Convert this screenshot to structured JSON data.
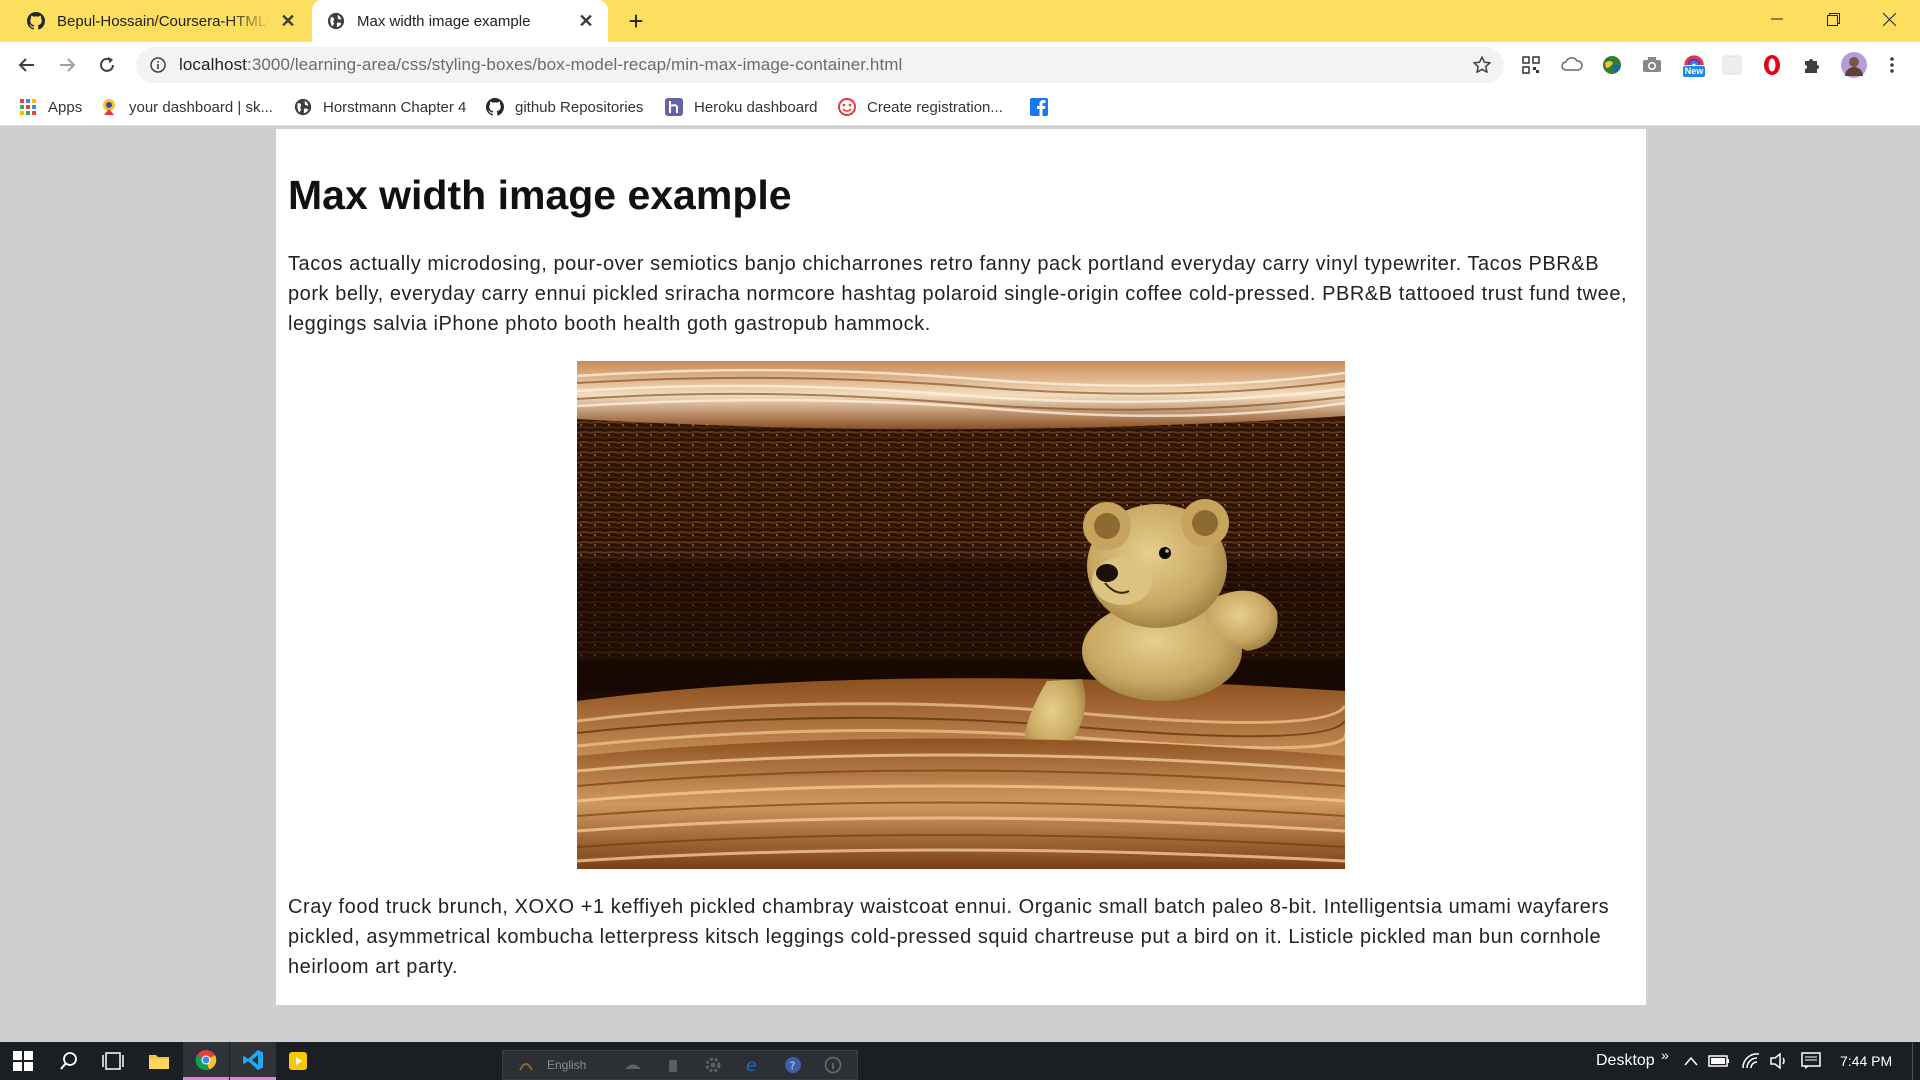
{
  "browser": {
    "tabs": [
      {
        "title": "Bepul-Hossain/Coursera-HTML-C",
        "icon": "github-icon",
        "active": false
      },
      {
        "title": "Max width image example",
        "icon": "globe-icon",
        "active": true
      }
    ],
    "new_tab_label": "+",
    "url": {
      "host": "localhost",
      "path": ":3000/learning-area/css/styling-boxes/box-model-recap/min-max-image-container.html"
    },
    "new_badge": "New",
    "bookmarks": [
      {
        "label": "Apps",
        "icon": "apps-grid-icon"
      },
      {
        "label": "your dashboard | sk...",
        "icon": "skill-logo-icon"
      },
      {
        "label": "Horstmann Chapter 4",
        "icon": "globe-icon"
      },
      {
        "label": "github Repositories",
        "icon": "github-icon"
      },
      {
        "label": "Heroku dashboard",
        "icon": "heroku-icon"
      },
      {
        "label": "Create registration...",
        "icon": "face-icon"
      },
      {
        "label": "",
        "icon": "facebook-icon"
      }
    ]
  },
  "page": {
    "heading": "Max width image example",
    "paragraph1": "Tacos actually microdosing, pour-over semiotics banjo chicharrones retro fanny pack portland everyday carry vinyl typewriter. Tacos PBR&B pork belly, everyday carry ennui pickled sriracha normcore hashtag polaroid single-origin coffee cold-pressed. PBR&B tattooed trust fund twee, leggings salvia iPhone photo booth health goth gastropub hammock.",
    "image_subject": "teddy bear in wicker basket",
    "paragraph2": "Cray food truck brunch, XOXO +1 keffiyeh pickled chambray waistcoat ennui. Organic small batch paleo 8-bit. Intelligentsia umami wayfarers pickled, asymmetrical kombucha letterpress kitsch leggings cold-pressed squid chartreuse put a bird on it. Listicle pickled man bun cornhole heirloom art party."
  },
  "taskbar": {
    "language": "English",
    "desktop_label": "Desktop",
    "overflow_label": "»",
    "time": "7:44 PM"
  },
  "colors": {
    "tabstrip": "#fddf5f",
    "page_bg": "#cfcfcf",
    "content_bg": "#ffffff",
    "taskbar": "#1b1f24"
  }
}
